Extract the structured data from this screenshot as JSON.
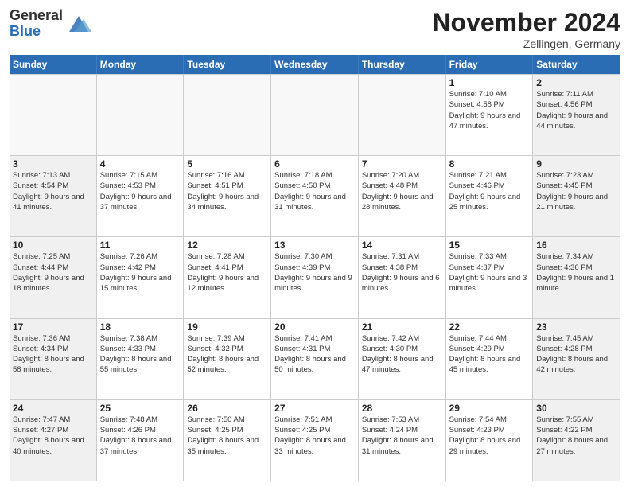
{
  "logo": {
    "general": "General",
    "blue": "Blue"
  },
  "header": {
    "month": "November 2024",
    "location": "Zellingen, Germany"
  },
  "weekdays": [
    "Sunday",
    "Monday",
    "Tuesday",
    "Wednesday",
    "Thursday",
    "Friday",
    "Saturday"
  ],
  "weeks": [
    [
      {
        "day": "",
        "info": ""
      },
      {
        "day": "",
        "info": ""
      },
      {
        "day": "",
        "info": ""
      },
      {
        "day": "",
        "info": ""
      },
      {
        "day": "",
        "info": ""
      },
      {
        "day": "1",
        "info": "Sunrise: 7:10 AM\nSunset: 4:58 PM\nDaylight: 9 hours and 47 minutes."
      },
      {
        "day": "2",
        "info": "Sunrise: 7:11 AM\nSunset: 4:56 PM\nDaylight: 9 hours and 44 minutes."
      }
    ],
    [
      {
        "day": "3",
        "info": "Sunrise: 7:13 AM\nSunset: 4:54 PM\nDaylight: 9 hours and 41 minutes."
      },
      {
        "day": "4",
        "info": "Sunrise: 7:15 AM\nSunset: 4:53 PM\nDaylight: 9 hours and 37 minutes."
      },
      {
        "day": "5",
        "info": "Sunrise: 7:16 AM\nSunset: 4:51 PM\nDaylight: 9 hours and 34 minutes."
      },
      {
        "day": "6",
        "info": "Sunrise: 7:18 AM\nSunset: 4:50 PM\nDaylight: 9 hours and 31 minutes."
      },
      {
        "day": "7",
        "info": "Sunrise: 7:20 AM\nSunset: 4:48 PM\nDaylight: 9 hours and 28 minutes."
      },
      {
        "day": "8",
        "info": "Sunrise: 7:21 AM\nSunset: 4:46 PM\nDaylight: 9 hours and 25 minutes."
      },
      {
        "day": "9",
        "info": "Sunrise: 7:23 AM\nSunset: 4:45 PM\nDaylight: 9 hours and 21 minutes."
      }
    ],
    [
      {
        "day": "10",
        "info": "Sunrise: 7:25 AM\nSunset: 4:44 PM\nDaylight: 9 hours and 18 minutes."
      },
      {
        "day": "11",
        "info": "Sunrise: 7:26 AM\nSunset: 4:42 PM\nDaylight: 9 hours and 15 minutes."
      },
      {
        "day": "12",
        "info": "Sunrise: 7:28 AM\nSunset: 4:41 PM\nDaylight: 9 hours and 12 minutes."
      },
      {
        "day": "13",
        "info": "Sunrise: 7:30 AM\nSunset: 4:39 PM\nDaylight: 9 hours and 9 minutes."
      },
      {
        "day": "14",
        "info": "Sunrise: 7:31 AM\nSunset: 4:38 PM\nDaylight: 9 hours and 6 minutes."
      },
      {
        "day": "15",
        "info": "Sunrise: 7:33 AM\nSunset: 4:37 PM\nDaylight: 9 hours and 3 minutes."
      },
      {
        "day": "16",
        "info": "Sunrise: 7:34 AM\nSunset: 4:36 PM\nDaylight: 9 hours and 1 minute."
      }
    ],
    [
      {
        "day": "17",
        "info": "Sunrise: 7:36 AM\nSunset: 4:34 PM\nDaylight: 8 hours and 58 minutes."
      },
      {
        "day": "18",
        "info": "Sunrise: 7:38 AM\nSunset: 4:33 PM\nDaylight: 8 hours and 55 minutes."
      },
      {
        "day": "19",
        "info": "Sunrise: 7:39 AM\nSunset: 4:32 PM\nDaylight: 8 hours and 52 minutes."
      },
      {
        "day": "20",
        "info": "Sunrise: 7:41 AM\nSunset: 4:31 PM\nDaylight: 8 hours and 50 minutes."
      },
      {
        "day": "21",
        "info": "Sunrise: 7:42 AM\nSunset: 4:30 PM\nDaylight: 8 hours and 47 minutes."
      },
      {
        "day": "22",
        "info": "Sunrise: 7:44 AM\nSunset: 4:29 PM\nDaylight: 8 hours and 45 minutes."
      },
      {
        "day": "23",
        "info": "Sunrise: 7:45 AM\nSunset: 4:28 PM\nDaylight: 8 hours and 42 minutes."
      }
    ],
    [
      {
        "day": "24",
        "info": "Sunrise: 7:47 AM\nSunset: 4:27 PM\nDaylight: 8 hours and 40 minutes."
      },
      {
        "day": "25",
        "info": "Sunrise: 7:48 AM\nSunset: 4:26 PM\nDaylight: 8 hours and 37 minutes."
      },
      {
        "day": "26",
        "info": "Sunrise: 7:50 AM\nSunset: 4:25 PM\nDaylight: 8 hours and 35 minutes."
      },
      {
        "day": "27",
        "info": "Sunrise: 7:51 AM\nSunset: 4:25 PM\nDaylight: 8 hours and 33 minutes."
      },
      {
        "day": "28",
        "info": "Sunrise: 7:53 AM\nSunset: 4:24 PM\nDaylight: 8 hours and 31 minutes."
      },
      {
        "day": "29",
        "info": "Sunrise: 7:54 AM\nSunset: 4:23 PM\nDaylight: 8 hours and 29 minutes."
      },
      {
        "day": "30",
        "info": "Sunrise: 7:55 AM\nSunset: 4:22 PM\nDaylight: 8 hours and 27 minutes."
      }
    ]
  ]
}
